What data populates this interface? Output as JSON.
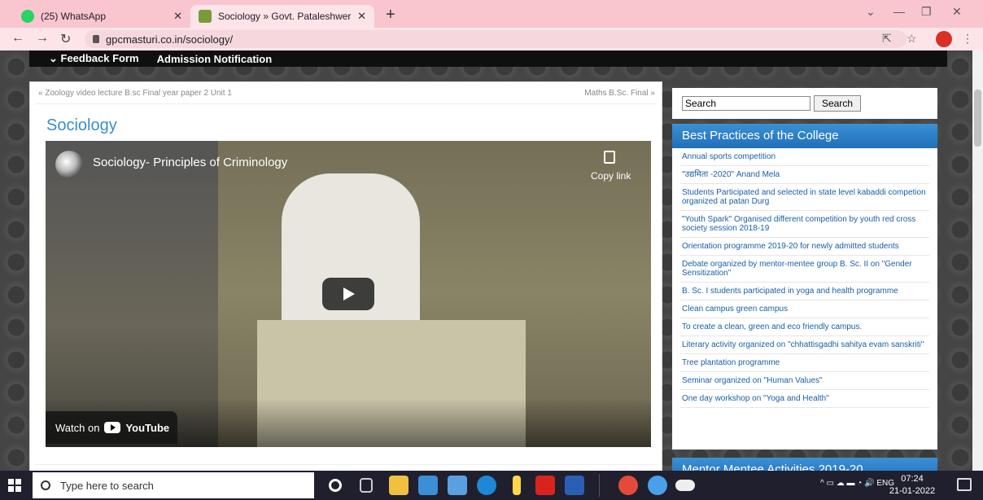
{
  "browser": {
    "tabs": [
      {
        "title": "(25) WhatsApp",
        "favicon": "whatsapp-icon"
      },
      {
        "title": "Sociology » Govt. Pataleshwer Co",
        "favicon": "college-icon"
      }
    ],
    "url": "gpcmasturi.co.in/sociology/"
  },
  "site": {
    "menu": [
      "Feedback Form",
      "Admission Notification"
    ],
    "prev_post": "« Zoology video lecture B.sc Final year paper 2 Unit 1",
    "next_post": "Maths B.Sc. Final »",
    "page_title": "Sociology",
    "video": {
      "title": "Sociology- Principles of Criminology",
      "copy_label": "Copy link",
      "watch_on": "Watch on",
      "youtube": "YouTube"
    }
  },
  "sidebar": {
    "search_value": "Search",
    "search_button": "Search",
    "best_practices_title": "Best Practices of the College",
    "best_practices": [
      "Annual sports competition",
      "\"उद्यमिता -2020\" Anand Mela",
      "Students Participated and selected in state level kabaddi competion organized at patan Durg",
      "\"Youth Spark\" Organised different competition by youth red cross society session 2018-19",
      "Orientation programme 2019-20 for newly admitted students",
      "Debate organized by mentor-mentee group B. Sc. II on \"Gender Sensitization\"",
      "B. Sc. I students participated in yoga and health programme",
      "Clean campus green campus",
      "To create a clean, green and eco friendly campus.",
      "Literary activity organized on \"chhattisgadhi sahitya evam sanskriti\"",
      "Tree plantation programme",
      "Seminar organized on \"Human Values\"",
      "One day workshop on \"Yoga and Health\""
    ],
    "mentor_title": "Mentor Mentee Activities 2019-20"
  },
  "taskbar": {
    "search_placeholder": "Type here to search",
    "tray_lang": "ENG",
    "time": "07:24",
    "date": "21-01-2022"
  }
}
